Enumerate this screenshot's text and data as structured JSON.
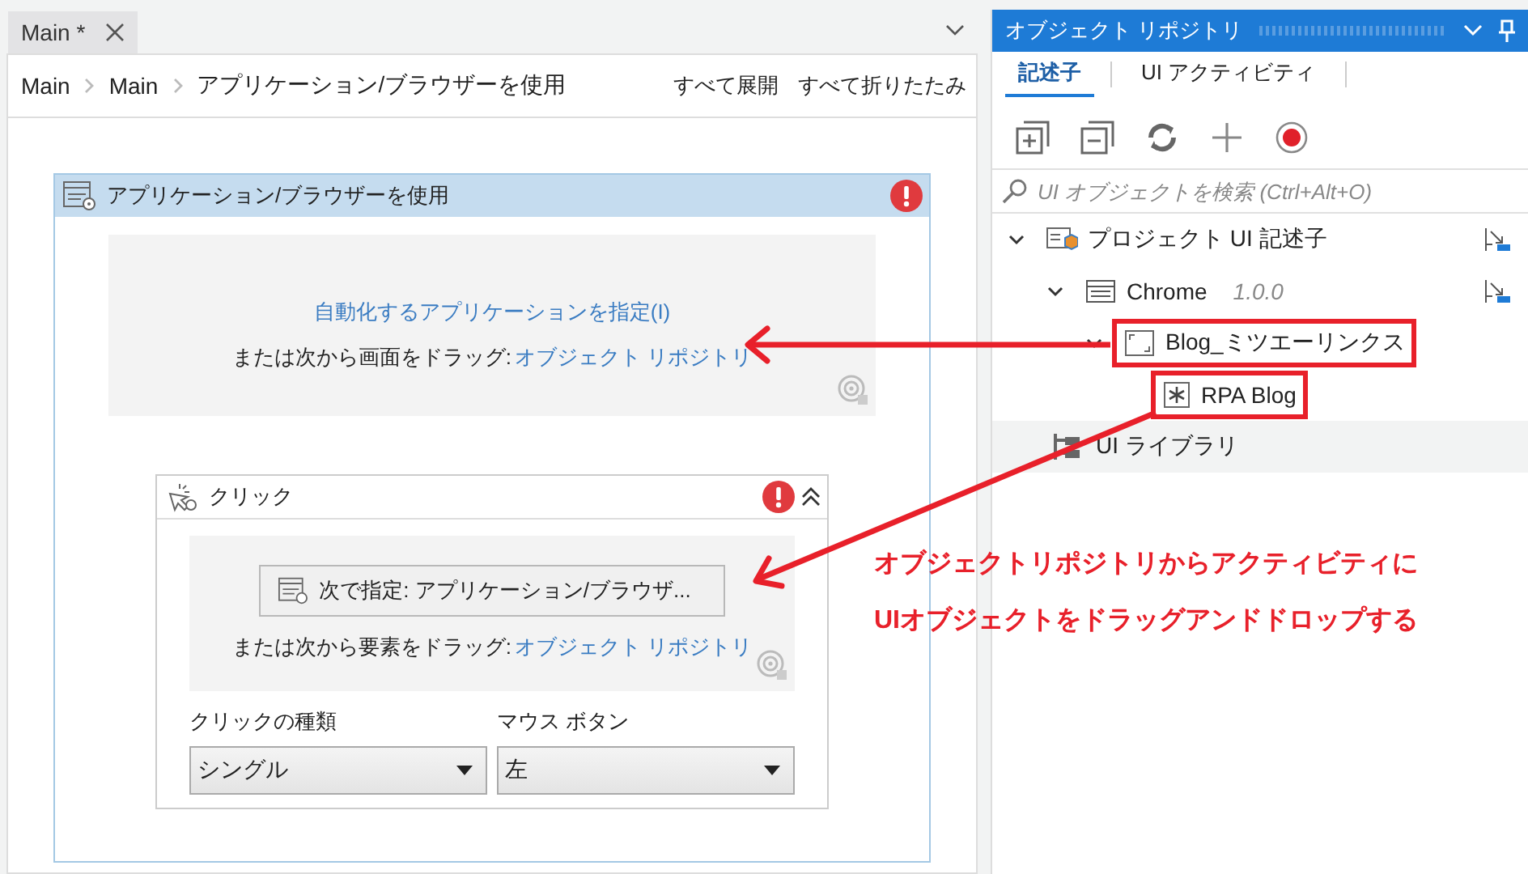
{
  "editor_tab": {
    "label": "Main *"
  },
  "breadcrumb": [
    "Main",
    "Main",
    "アプリケーション/ブラウザーを使用"
  ],
  "toolbar_links": [
    "すべて展開",
    "すべて折りたたみ"
  ],
  "scope_activity": {
    "title": "アプリケーション/ブラウザーを使用",
    "has_error": true,
    "target_link": "自動化するアプリケーションを指定(I)",
    "drag_hint": "または次から画面をドラッグ:",
    "drag_link": "オブジェクト リポジトリ"
  },
  "click_activity": {
    "title": "クリック",
    "has_error": true,
    "target_button": "次で指定: アプリケーション/ブラウザ...",
    "drag_hint": "または次から要素をドラッグ:",
    "drag_link": "オブジェクト リポジトリ",
    "fields": [
      {
        "label": "クリックの種類",
        "value": "シングル"
      },
      {
        "label": "マウス ボタン",
        "value": "左"
      }
    ]
  },
  "object_repository": {
    "title": "オブジェクト リポジトリ",
    "tabs": [
      {
        "label": "記述子",
        "selected": true
      },
      {
        "label": "UI アクティビティ",
        "selected": false
      }
    ],
    "search": {
      "placeholder": "UI オブジェクトを検索 (Ctrl+Alt+O)"
    },
    "tree": [
      {
        "label": "プロジェクト UI 記述子",
        "expanded": true,
        "children": [
          {
            "label": "Chrome",
            "version": "1.0.0",
            "expanded": true,
            "children": [
              {
                "label": "Blog_ミツエーリンクス",
                "highlighted": true,
                "expanded": true,
                "children": [
                  {
                    "label": "RPA Blog",
                    "highlighted": true
                  }
                ]
              }
            ]
          }
        ]
      }
    ],
    "library": {
      "label": "UI ライブラリ"
    }
  },
  "annotation": {
    "lines": [
      "オブジェクトリポジトリからアクティビティに",
      "UIオブジェクトをドラッグアンドドロップする"
    ]
  }
}
